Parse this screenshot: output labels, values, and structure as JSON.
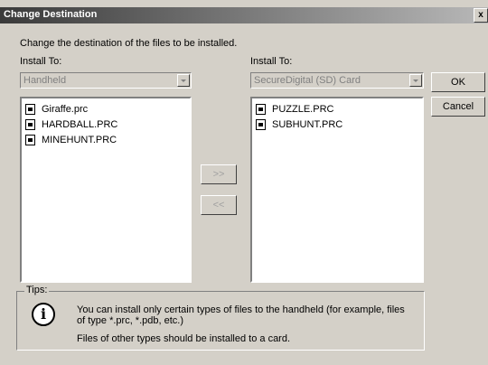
{
  "window": {
    "title": "Change Destination",
    "close_label": "x"
  },
  "description": "Change the destination of the files to be installed.",
  "left": {
    "label": "Install To:",
    "combo_value": "Handheld",
    "files": [
      "Giraffe.prc",
      "HARDBALL.PRC",
      "MINEHUNT.PRC"
    ]
  },
  "right": {
    "label": "Install To:",
    "combo_value": "SecureDigital (SD) Card",
    "files": [
      "PUZZLE.PRC",
      "SUBHUNT.PRC"
    ]
  },
  "buttons": {
    "move_right": ">>",
    "move_left": "<<",
    "ok": "OK",
    "cancel": "Cancel"
  },
  "tips": {
    "label": "Tips:",
    "line1": "You can install only certain types of files to the handheld (for example, files of type *.prc, *.pdb, etc.)",
    "line2": "Files of other types should be installed to a card."
  }
}
